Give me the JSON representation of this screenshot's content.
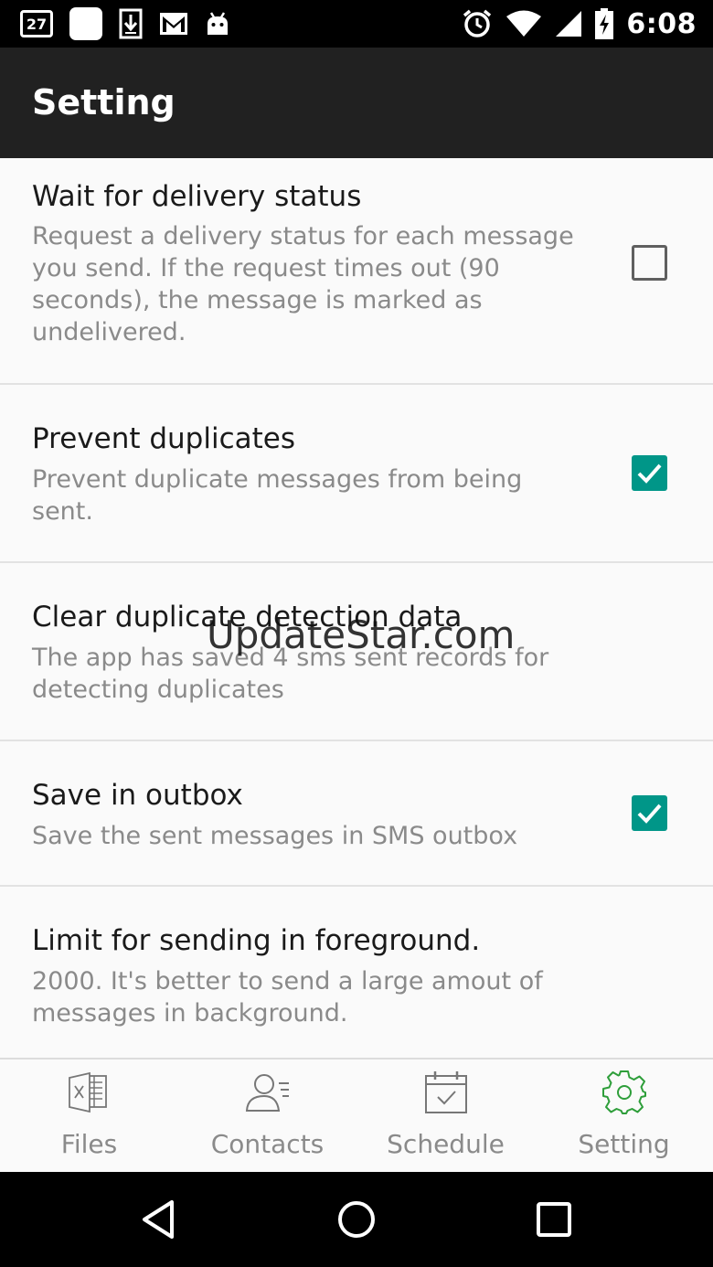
{
  "status_bar": {
    "calendar_day": "27",
    "time": "6:08",
    "icons": [
      "calendar-icon",
      "app-icon",
      "download-icon",
      "gmail-icon",
      "android-icon",
      "alarm-icon",
      "wifi-icon",
      "signal-icon",
      "battery-charging-icon"
    ]
  },
  "appbar": {
    "title": "Setting"
  },
  "settings": [
    {
      "title": "Wait for delivery status",
      "summary": "Request a delivery status for each message you send. If the request times out (90 seconds), the message is marked as undelivered.",
      "checked": false
    },
    {
      "title": "Prevent duplicates",
      "summary": "Prevent duplicate messages from being sent.",
      "checked": true
    },
    {
      "title": "Clear duplicate detection data",
      "summary": "The app has saved 4 sms sent records for detecting duplicates"
    },
    {
      "title": "Save in outbox",
      "summary": "Save the sent messages in SMS outbox",
      "checked": true
    },
    {
      "title": "Limit for sending in foreground.",
      "summary": "2000. It's better to send a large amout of messages in background."
    }
  ],
  "watermark": "UpdateStar.com",
  "tabs": [
    {
      "label": "Files",
      "icon": "excel-file-icon",
      "active": false
    },
    {
      "label": "Contacts",
      "icon": "contacts-icon",
      "active": false
    },
    {
      "label": "Schedule",
      "icon": "calendar-check-icon",
      "active": false
    },
    {
      "label": "Setting",
      "icon": "gear-icon",
      "active": true
    }
  ],
  "colors": {
    "accent": "#009688",
    "active_tab_icon": "#2e9e3a",
    "appbar": "#212121"
  }
}
